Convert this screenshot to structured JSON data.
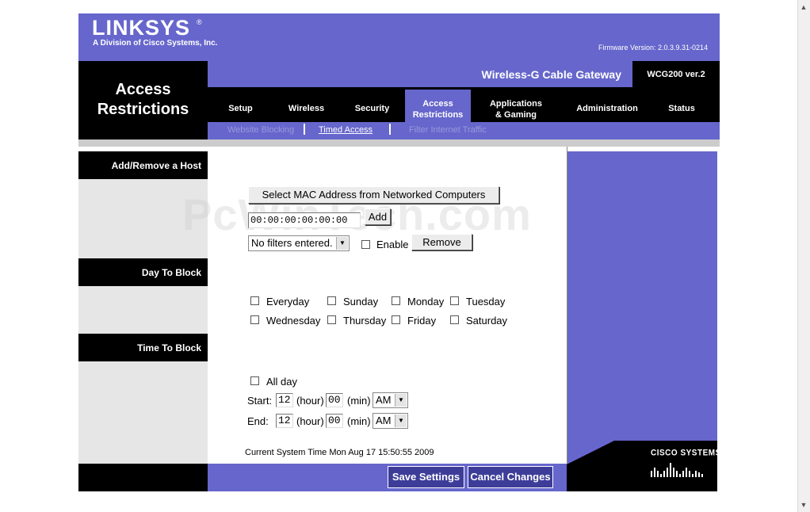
{
  "header": {
    "brand": "LINKSYS",
    "brand_reg": "®",
    "tagline": "A Division of Cisco Systems, Inc.",
    "firmware": "Firmware Version: 2.0.3.9.31-0214",
    "page_title_line1": "Access",
    "page_title_line2": "Restrictions",
    "product_name": "Wireless-G Cable Gateway",
    "model": "WCG200 ver.2"
  },
  "nav": {
    "setup": "Setup",
    "wireless": "Wireless",
    "security": "Security",
    "access_line1": "Access",
    "access_line2": "Restrictions",
    "apps_line1": "Applications",
    "apps_line2": "& Gaming",
    "administration": "Administration",
    "status": "Status"
  },
  "subnav": {
    "website_blocking": "Website Blocking",
    "timed_access": "Timed Access",
    "filter_internet": "Filter Internet Traffic"
  },
  "sections": {
    "add_remove": "Add/Remove a Host",
    "day_to_block": "Day To Block",
    "time_to_block": "Time To Block"
  },
  "host": {
    "select_mac_label": "Select MAC Address from Networked Computers",
    "mac_value": "00:00:00:00:00:00",
    "add_label": "Add",
    "filter_selected": "No filters entered.",
    "enable_label": "Enable",
    "remove_label": "Remove"
  },
  "days": {
    "everyday": "Everyday",
    "sunday": "Sunday",
    "monday": "Monday",
    "tuesday": "Tuesday",
    "wednesday": "Wednesday",
    "thursday": "Thursday",
    "friday": "Friday",
    "saturday": "Saturday"
  },
  "time": {
    "all_day": "All day",
    "start_label": "Start:",
    "end_label": "End:",
    "start_hour": "12",
    "start_min": "00",
    "start_ampm": "AM",
    "end_hour": "12",
    "end_min": "00",
    "end_ampm": "AM",
    "hour_unit": "(hour)",
    "min_unit": "(min)"
  },
  "system_time": "Current System Time Mon Aug 17 15:50:55 2009",
  "actions": {
    "save": "Save Settings",
    "cancel": "Cancel Changes"
  },
  "footer_logo": "CISCO SYSTEMS",
  "watermark": "PcWinTech.com",
  "colors": {
    "accent_purple": "#6666cc",
    "dark": "#000000",
    "button_blue": "#3d3d99"
  }
}
